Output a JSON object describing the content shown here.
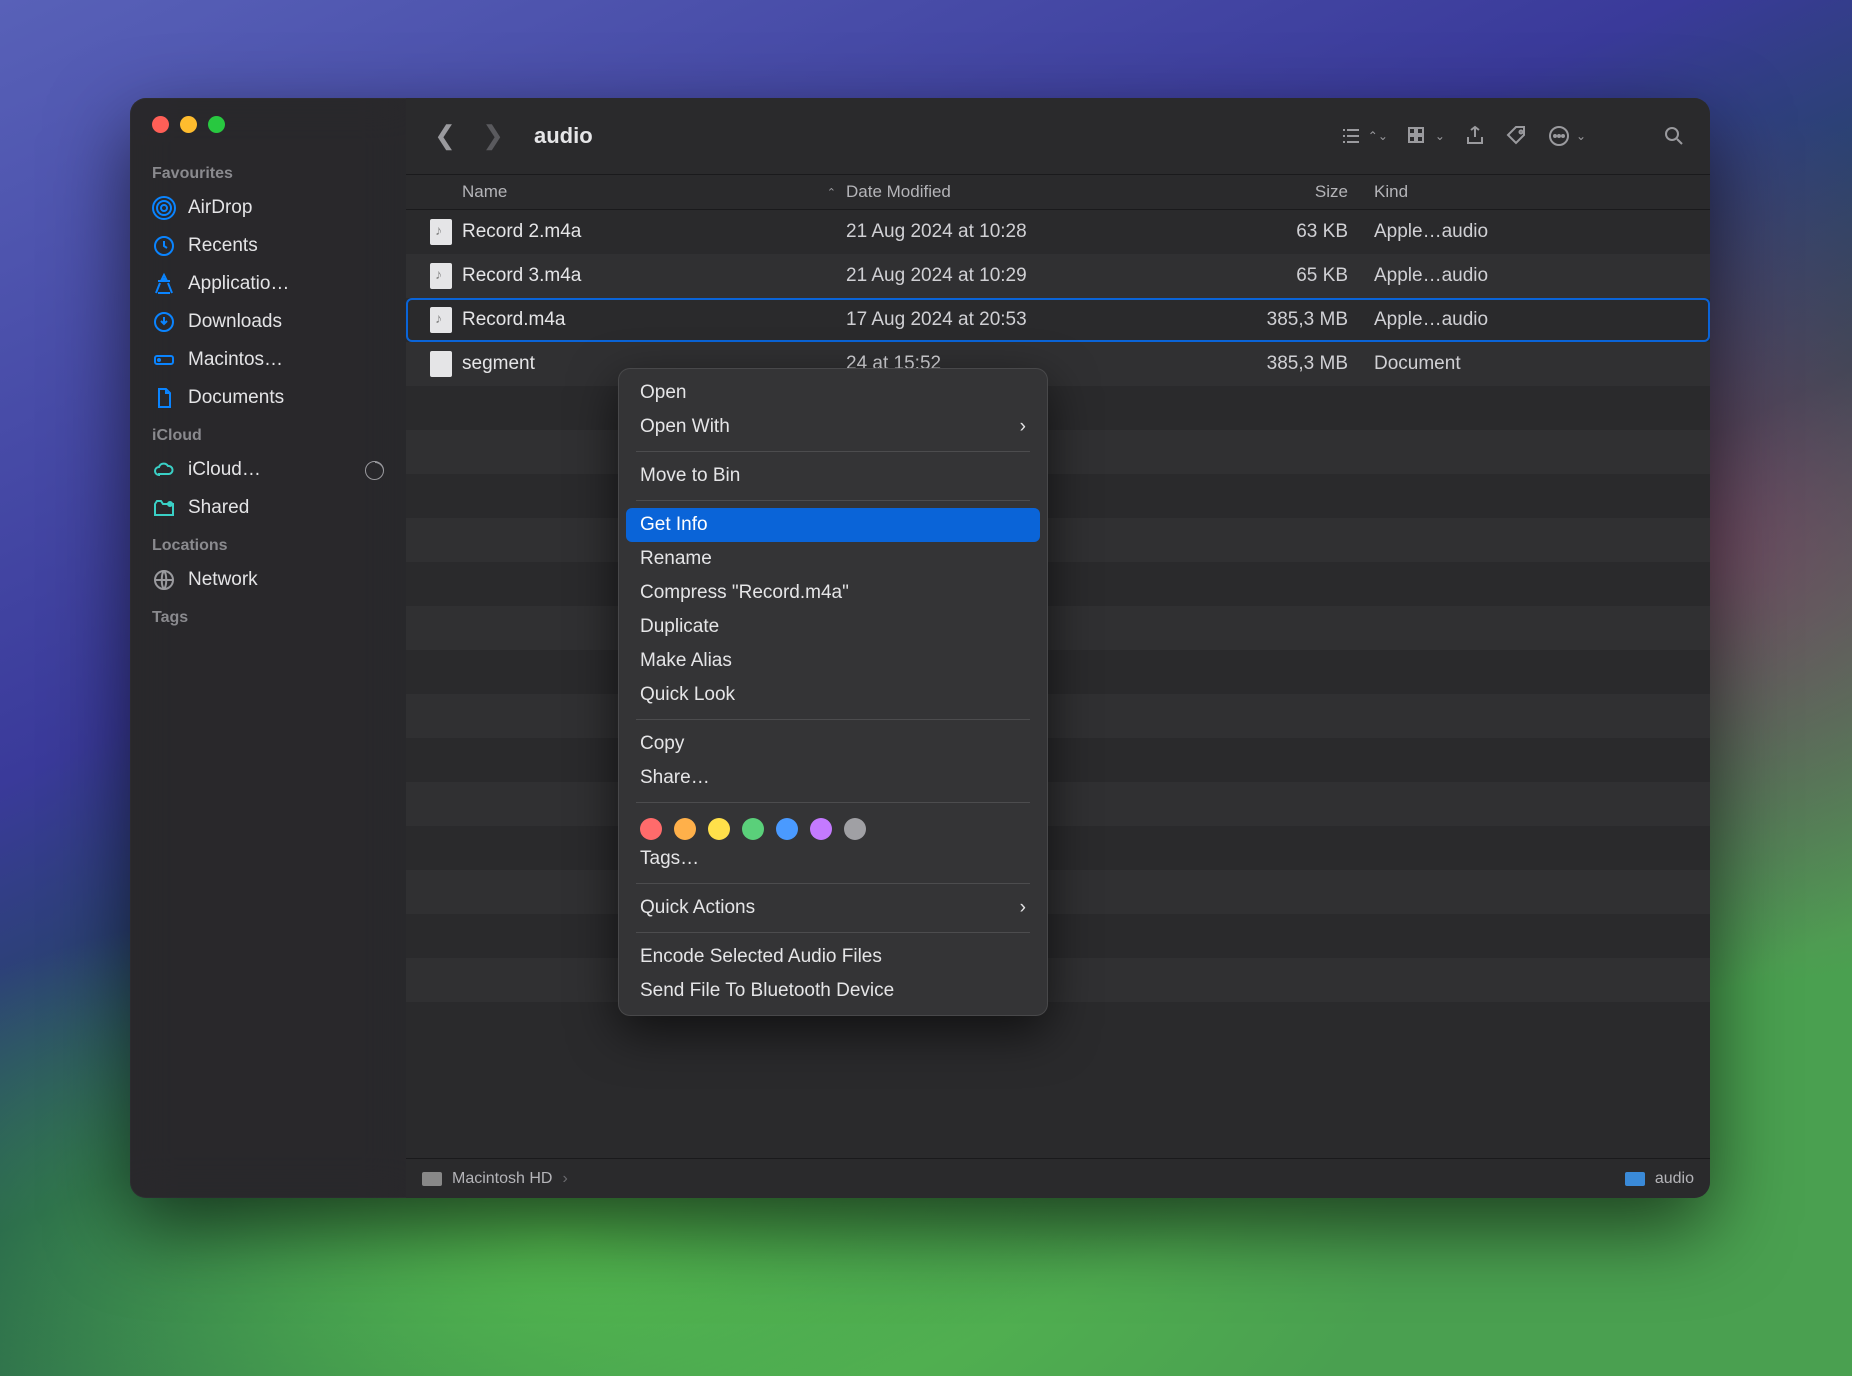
{
  "window_title": "audio",
  "sidebar": {
    "favourites_label": "Favourites",
    "icloud_label": "iCloud",
    "locations_label": "Locations",
    "tags_label": "Tags",
    "items": {
      "airdrop": "AirDrop",
      "recents": "Recents",
      "applications": "Applicatio…",
      "downloads": "Downloads",
      "macintosh": "Macintos…",
      "documents": "Documents",
      "icloud_drive": "iCloud…",
      "shared": "Shared",
      "network": "Network"
    }
  },
  "columns": {
    "name": "Name",
    "date": "Date Modified",
    "size": "Size",
    "kind": "Kind"
  },
  "files": [
    {
      "name": "Record 2.m4a",
      "date": "21 Aug 2024 at 10:28",
      "size": "63 KB",
      "kind": "Apple…audio"
    },
    {
      "name": "Record 3.m4a",
      "date": "21 Aug 2024 at 10:29",
      "size": "65 KB",
      "kind": "Apple…audio"
    },
    {
      "name": "Record.m4a",
      "date": "17 Aug 2024 at 20:53",
      "size": "385,3 MB",
      "kind": "Apple…audio"
    },
    {
      "name": "segment",
      "date": "24 at 15:52",
      "size": "385,3 MB",
      "kind": "Document"
    }
  ],
  "selected_index": 2,
  "pathbar": {
    "root": "Macintosh HD",
    "leaf": "audio"
  },
  "context_menu": {
    "open": "Open",
    "open_with": "Open With",
    "move_to_bin": "Move to Bin",
    "get_info": "Get Info",
    "rename": "Rename",
    "compress": "Compress \"Record.m4a\"",
    "duplicate": "Duplicate",
    "make_alias": "Make Alias",
    "quick_look": "Quick Look",
    "copy": "Copy",
    "share": "Share…",
    "tags": "Tags…",
    "quick_actions": "Quick Actions",
    "encode": "Encode Selected Audio Files",
    "bluetooth": "Send File To Bluetooth Device",
    "highlighted": "get_info"
  }
}
